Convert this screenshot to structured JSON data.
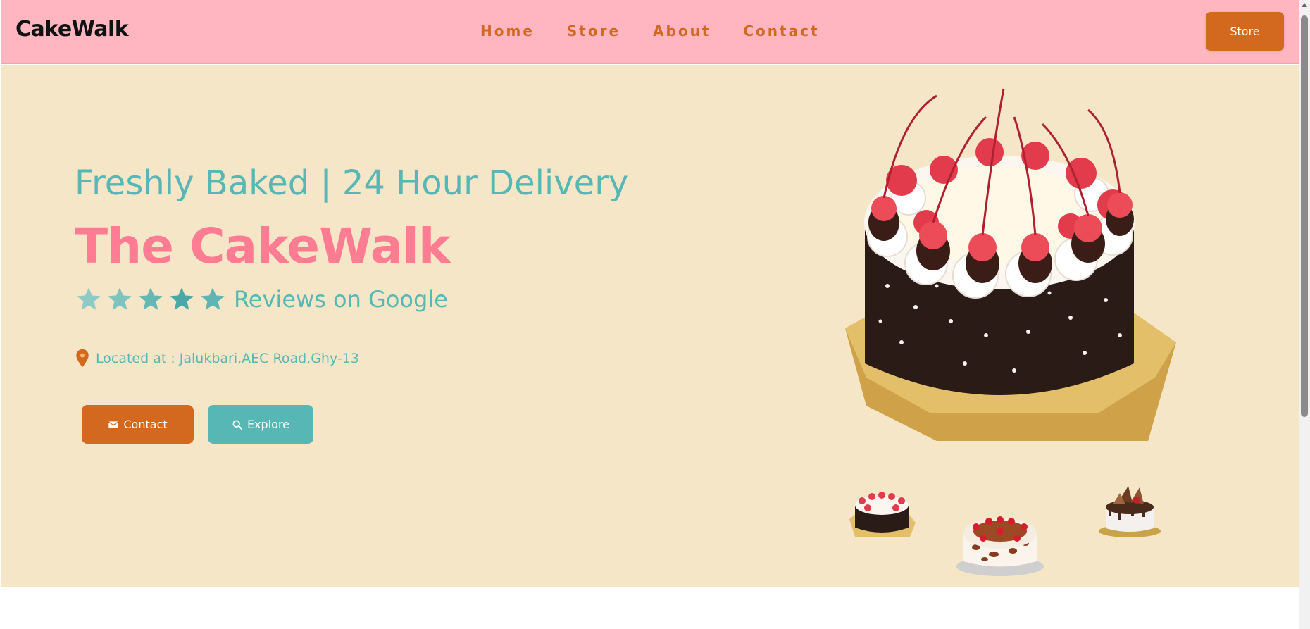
{
  "brand": {
    "logo": "CakeWalk"
  },
  "nav": {
    "items": [
      "Home",
      "Store",
      "About",
      "Contact"
    ]
  },
  "header": {
    "store_button": "Store"
  },
  "hero": {
    "tagline": "Freshly Baked | 24 Hour Delivery",
    "title": "The CakeWalk",
    "reviews_text": "Reviews on Google",
    "rating_stars": 5,
    "location": "Located at : Jalukbari,AEC Road,Ghy-13",
    "contact_button": "Contact",
    "explore_button": "Explore"
  },
  "colors": {
    "header_bg": "#ffb6c1",
    "hero_bg": "#f5e6c8",
    "accent_orange": "#d2691e",
    "accent_teal": "#56b7b4",
    "title_pink": "#ff7c93"
  },
  "icons": {
    "star": "star-icon",
    "pin": "location-pin-icon",
    "envelope": "envelope-icon",
    "search": "search-icon"
  }
}
